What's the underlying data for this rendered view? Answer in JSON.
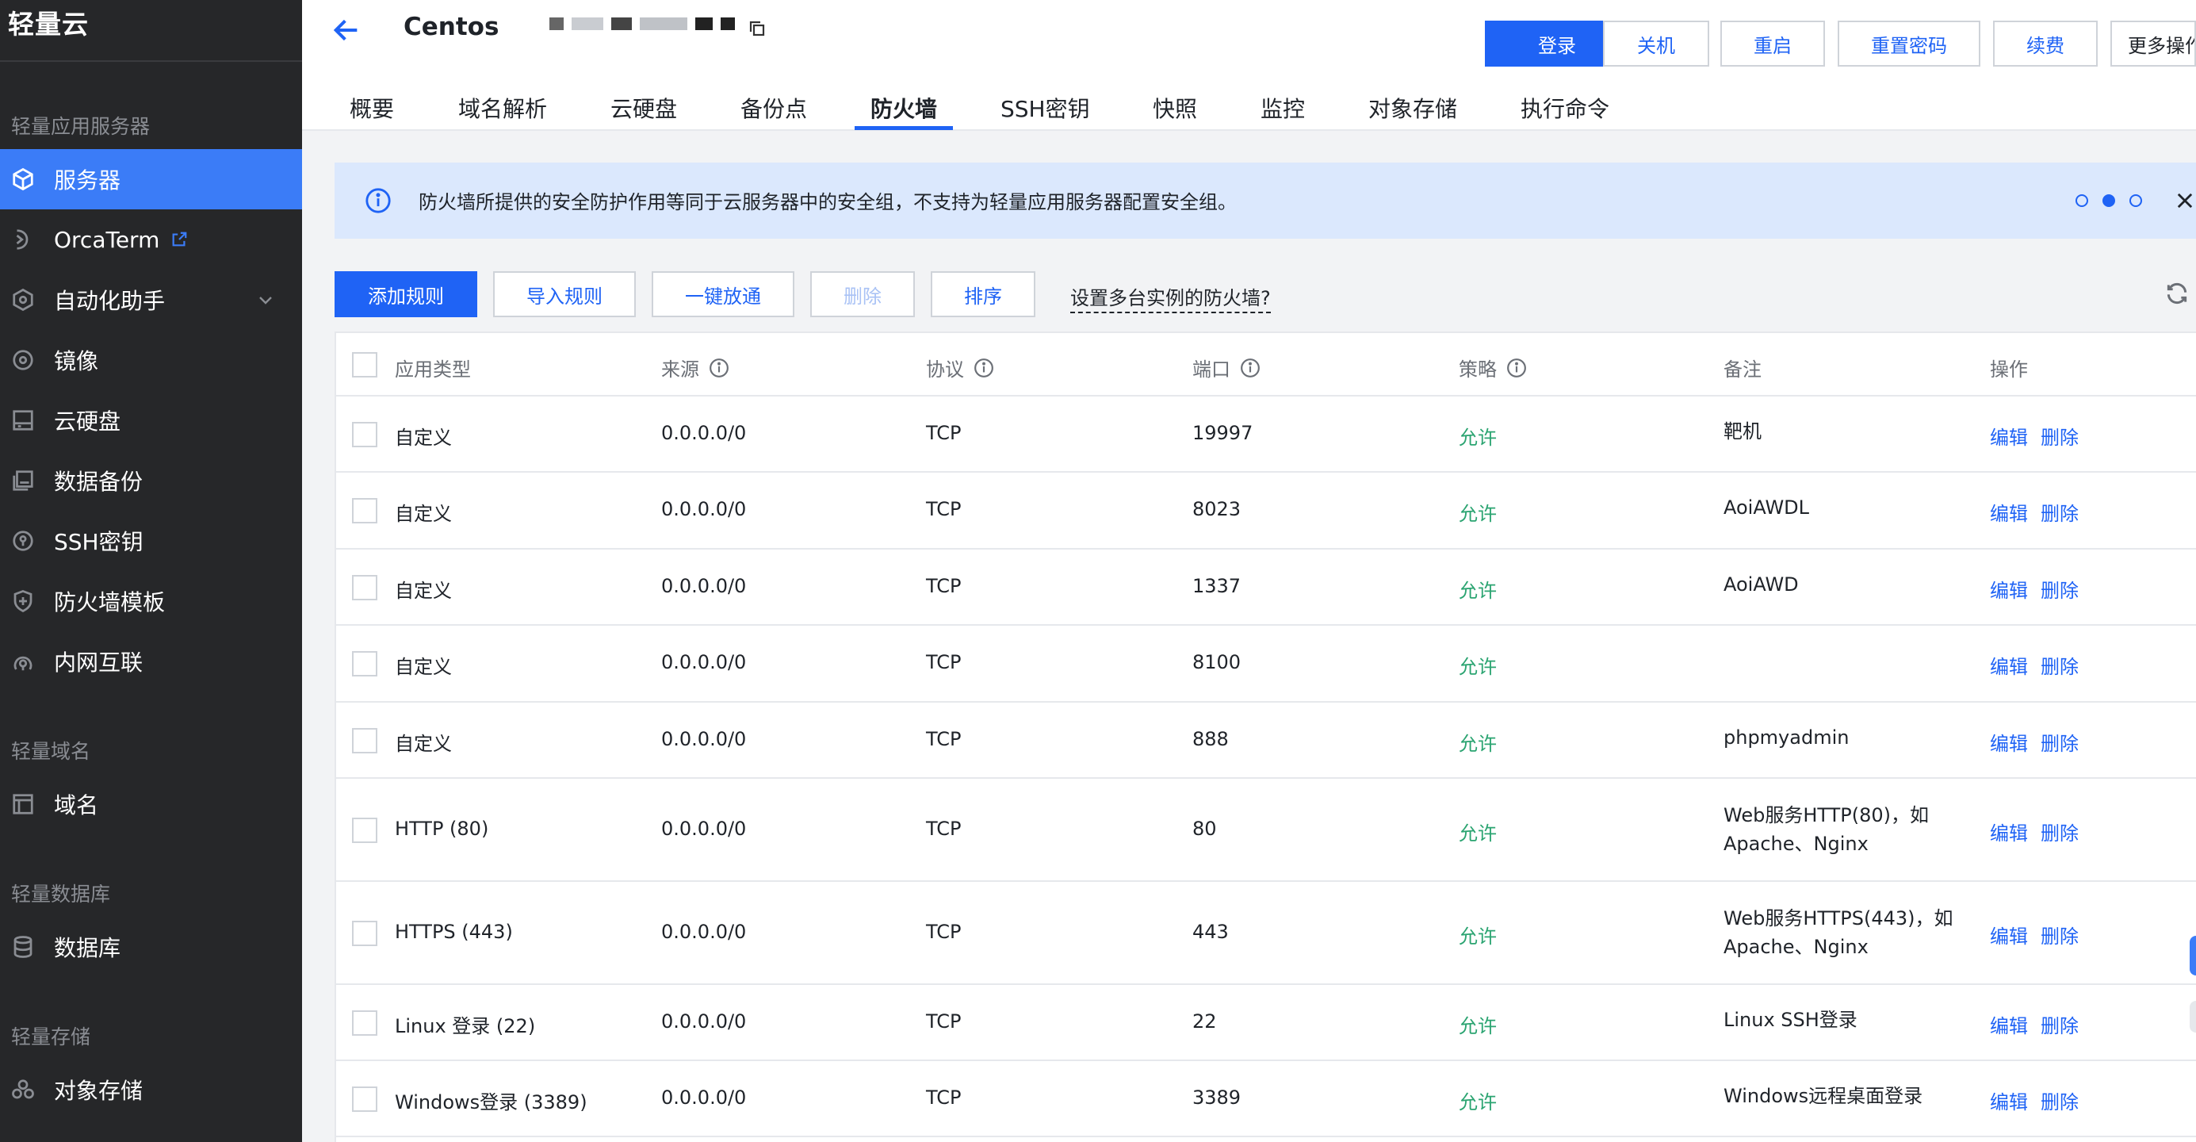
{
  "sidebar": {
    "brand": "轻量云",
    "groups": {
      "server": "轻量应用服务器",
      "domain": "轻量域名",
      "database": "轻量数据库",
      "storage": "轻量存储"
    },
    "items": [
      {
        "label": "服务器",
        "icon": "server-icon"
      },
      {
        "label": "OrcaTerm",
        "icon": "orcaterm-icon"
      },
      {
        "label": "自动化助手",
        "icon": "automation-icon"
      },
      {
        "label": "镜像",
        "icon": "image-icon"
      },
      {
        "label": "云硬盘",
        "icon": "disk-icon"
      },
      {
        "label": "数据备份",
        "icon": "backup-icon"
      },
      {
        "label": "SSH密钥",
        "icon": "ssh-key-icon"
      },
      {
        "label": "防火墙模板",
        "icon": "firewall-icon"
      },
      {
        "label": "内网互联",
        "icon": "network-icon"
      },
      {
        "label": "域名",
        "icon": "domain-icon"
      },
      {
        "label": "数据库",
        "icon": "database-icon"
      },
      {
        "label": "对象存储",
        "icon": "object-storage-icon"
      }
    ]
  },
  "header": {
    "title": "Centos",
    "buttons": {
      "login": "登录",
      "shutdown": "关机",
      "restart": "重启",
      "reset_password": "重置密码",
      "renew": "续费",
      "more": "更多操作"
    },
    "tabs": [
      "概要",
      "域名解析",
      "云硬盘",
      "备份点",
      "防火墙",
      "SSH密钥",
      "快照",
      "监控",
      "对象存储",
      "执行命令"
    ],
    "active_tab": "防火墙"
  },
  "banner": {
    "text": "防火墙所提供的安全防护作用等同于云服务器中的安全组，不支持为轻量应用服务器配置安全组。"
  },
  "toolbar": {
    "add_rule": "添加规则",
    "import_rules": "导入规则",
    "open_all": "一键放通",
    "delete": "删除",
    "sort": "排序",
    "multi_instance_link": "设置多台实例的防火墙?"
  },
  "table": {
    "columns": {
      "app_type": "应用类型",
      "source": "来源",
      "protocol": "协议",
      "port": "端口",
      "policy": "策略",
      "note": "备注",
      "action": "操作"
    },
    "edit_label": "编辑",
    "delete_label": "删除",
    "rows": [
      {
        "app_type": "自定义",
        "source": "0.0.0.0/0",
        "protocol": "TCP",
        "port": "19997",
        "policy": "允许",
        "note_l1": "靶机",
        "note_l2": ""
      },
      {
        "app_type": "自定义",
        "source": "0.0.0.0/0",
        "protocol": "TCP",
        "port": "8023",
        "policy": "允许",
        "note_l1": "AoiAWDL",
        "note_l2": ""
      },
      {
        "app_type": "自定义",
        "source": "0.0.0.0/0",
        "protocol": "TCP",
        "port": "1337",
        "policy": "允许",
        "note_l1": "AoiAWD",
        "note_l2": ""
      },
      {
        "app_type": "自定义",
        "source": "0.0.0.0/0",
        "protocol": "TCP",
        "port": "8100",
        "policy": "允许",
        "note_l1": "",
        "note_l2": ""
      },
      {
        "app_type": "自定义",
        "source": "0.0.0.0/0",
        "protocol": "TCP",
        "port": "888",
        "policy": "允许",
        "note_l1": "phpmyadmin",
        "note_l2": ""
      },
      {
        "app_type": "HTTP (80)",
        "source": "0.0.0.0/0",
        "protocol": "TCP",
        "port": "80",
        "policy": "允许",
        "note_l1": "Web服务HTTP(80)，如",
        "note_l2": "Apache、Nginx"
      },
      {
        "app_type": "HTTPS (443)",
        "source": "0.0.0.0/0",
        "protocol": "TCP",
        "port": "443",
        "policy": "允许",
        "note_l1": "Web服务HTTPS(443)，如",
        "note_l2": "Apache、Nginx"
      },
      {
        "app_type": "Linux 登录 (22)",
        "source": "0.0.0.0/0",
        "protocol": "TCP",
        "port": "22",
        "policy": "允许",
        "note_l1": "Linux SSH登录",
        "note_l2": ""
      },
      {
        "app_type": "Windows登录 (3389)",
        "source": "0.0.0.0/0",
        "protocol": "TCP",
        "port": "3389",
        "policy": "允许",
        "note_l1": "Windows远程桌面登录",
        "note_l2": ""
      }
    ]
  },
  "colors": {
    "accent": "#1f63f5",
    "sidebar_bg": "#262729",
    "sidebar_active": "#3b7cf7",
    "allow_green": "#2ba471",
    "banner_bg": "#dbe8fd"
  }
}
